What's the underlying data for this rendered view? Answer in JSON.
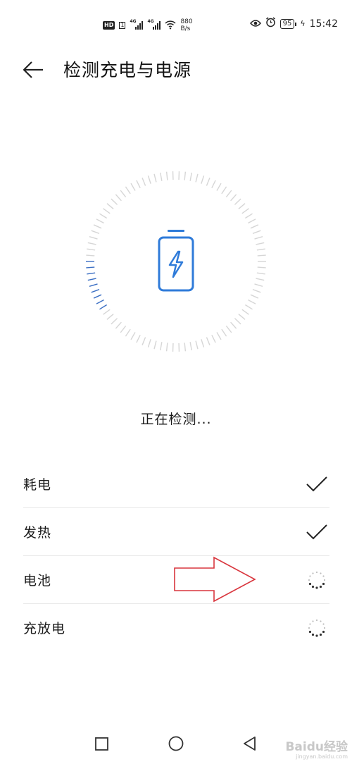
{
  "status_bar": {
    "hd_badge": "HD",
    "sim_tag": "1",
    "network_type_1": "4G",
    "network_type_2": "4G",
    "speed_value": "880",
    "speed_unit": "B/s",
    "battery_level": "95",
    "time": "15:42"
  },
  "header": {
    "title": "检测充电与电源"
  },
  "status_text": "正在检测...",
  "checks": [
    {
      "label": "耗电",
      "state": "done"
    },
    {
      "label": "发热",
      "state": "done"
    },
    {
      "label": "电池",
      "state": "loading"
    },
    {
      "label": "充放电",
      "state": "loading"
    }
  ],
  "gauge": {
    "progress_fraction": 0.1,
    "tick_color_active": "#3b6fc4",
    "tick_color_inactive": "#d6d6d6",
    "battery_icon_color": "#2f7bd9"
  },
  "watermark": {
    "brand": "Baidu经验",
    "url": "jingyan.baidu.com"
  },
  "colors": {
    "annotation_arrow": "#d9363e"
  }
}
